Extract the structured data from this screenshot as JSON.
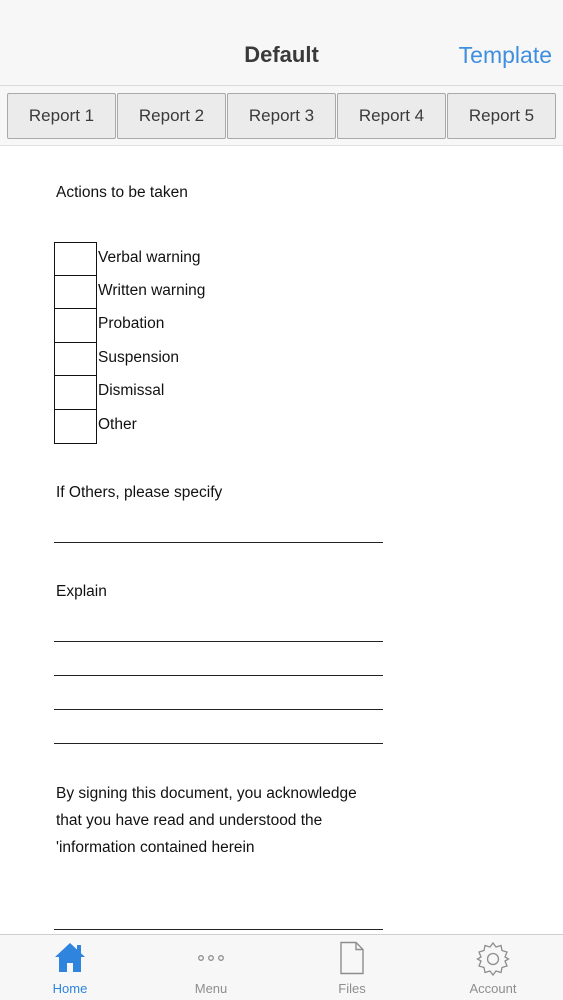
{
  "nav": {
    "title": "Default",
    "action": "Template"
  },
  "segments": [
    "Report 1",
    "Report 2",
    "Report 3",
    "Report 4",
    "Report 5"
  ],
  "form": {
    "actions_heading": "Actions to be taken",
    "options": [
      "Verbal warning",
      "Written warning",
      "Probation",
      "Suspension",
      "Dismissal",
      "Other"
    ],
    "others_label": "If Others, please specify",
    "explain_label": "Explain",
    "acknowledge_lines": [
      "By signing this document, you acknowledge",
      "that you have read and understood the",
      "'information contained herein"
    ]
  },
  "tabs": [
    {
      "label": "Home",
      "icon": "home-icon",
      "active": true
    },
    {
      "label": "Menu",
      "icon": "more-icon",
      "active": false
    },
    {
      "label": "Files",
      "icon": "file-icon",
      "active": false
    },
    {
      "label": "Account",
      "icon": "gear-icon",
      "active": false
    }
  ],
  "colors": {
    "accent": "#3f8fe0",
    "active_tab": "#2f84dd",
    "inactive_tab": "#8e8e8e"
  }
}
